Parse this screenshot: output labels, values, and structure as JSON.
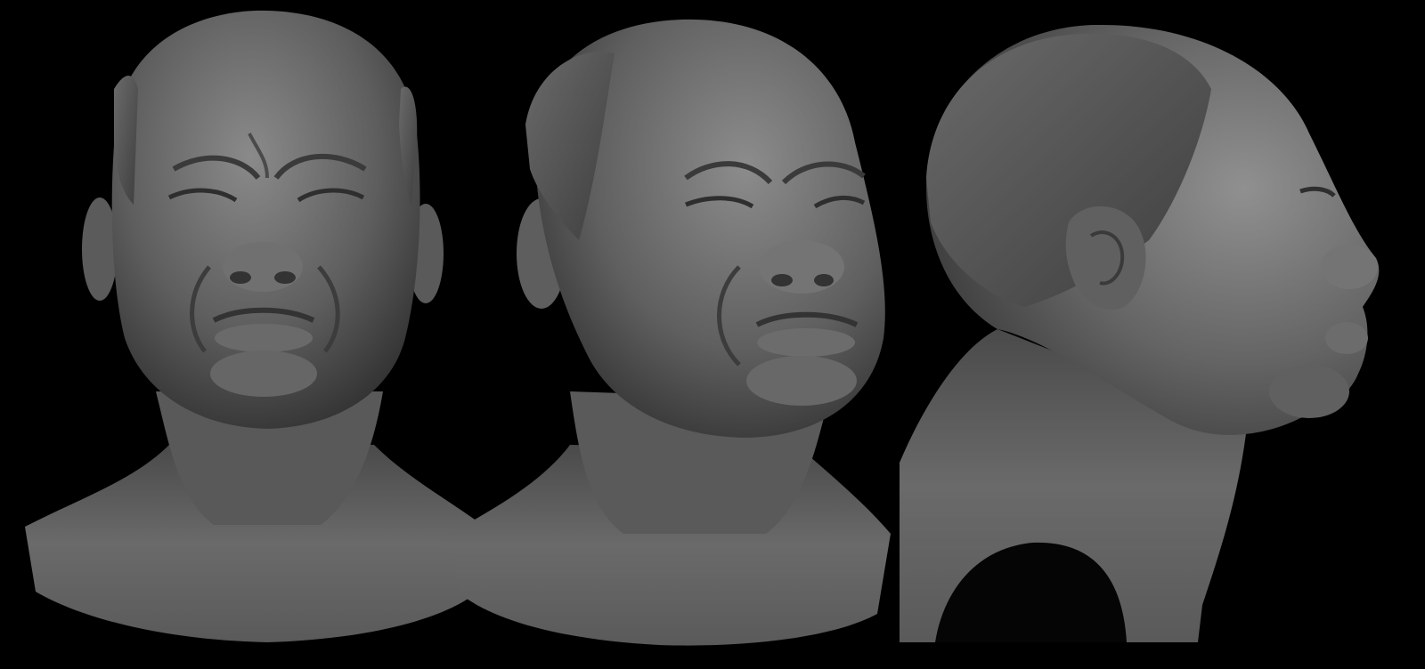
{
  "scene": {
    "background_color": "#000000",
    "material_color": "#6e6e6e",
    "views": [
      {
        "id": "front",
        "description_hidden": true
      },
      {
        "id": "three-quarter",
        "description_hidden": true
      },
      {
        "id": "profile",
        "description_hidden": true
      }
    ]
  }
}
